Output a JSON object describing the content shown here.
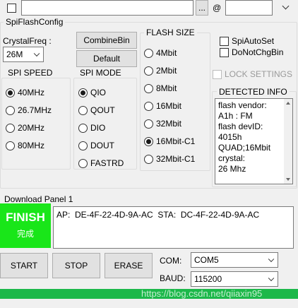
{
  "top_bar": {
    "browse_label": "...",
    "at_label": "@",
    "path_value": "",
    "offset_value": ""
  },
  "window_title": "SpiFlashConfig",
  "crystal": {
    "label": "CrystalFreq :",
    "value": "26M"
  },
  "buttons": {
    "combine": "CombineBin",
    "default": "Default",
    "start": "START",
    "stop": "STOP",
    "erase": "ERASE"
  },
  "flash_size": {
    "title": "FLASH SIZE",
    "options": [
      "4Mbit",
      "2Mbit",
      "8Mbit",
      "16Mbit",
      "32Mbit",
      "16Mbit-C1",
      "32Mbit-C1"
    ],
    "selected": "16Mbit-C1"
  },
  "spi_speed": {
    "title": "SPI SPEED",
    "options": [
      "40MHz",
      "26.7MHz",
      "20MHz",
      "80MHz"
    ],
    "selected": "40MHz"
  },
  "spi_mode": {
    "title": "SPI MODE",
    "options": [
      "QIO",
      "QOUT",
      "DIO",
      "DOUT",
      "FASTRD"
    ],
    "selected": "QIO"
  },
  "checks": {
    "auto_set": "SpiAutoSet",
    "do_not_chg": "DoNotChgBin",
    "lock": "LOCK SETTINGS"
  },
  "detected": {
    "title": "DETECTED INFO",
    "lines": [
      "flash vendor:",
      "A1h : FM",
      "flash devID:",
      "4015h",
      "QUAD;16Mbit",
      "crystal:",
      "26 Mhz"
    ]
  },
  "download": {
    "panel_label": "Download Panel 1",
    "status": "FINISH",
    "status_sub": "完成",
    "mac_text": "AP:  DE-4F-22-4D-9A-AC  STA:  DC-4F-22-4D-9A-AC",
    "status_color": "#19e619"
  },
  "com": {
    "label": "COM:",
    "value": "COM5"
  },
  "baud": {
    "label": "BAUD:",
    "value": "115200"
  },
  "watermark": "https://blog.csdn.net/qiiaxin95",
  "colors": {
    "progress": "#1cb84a",
    "finish_bg": "#19e619"
  }
}
